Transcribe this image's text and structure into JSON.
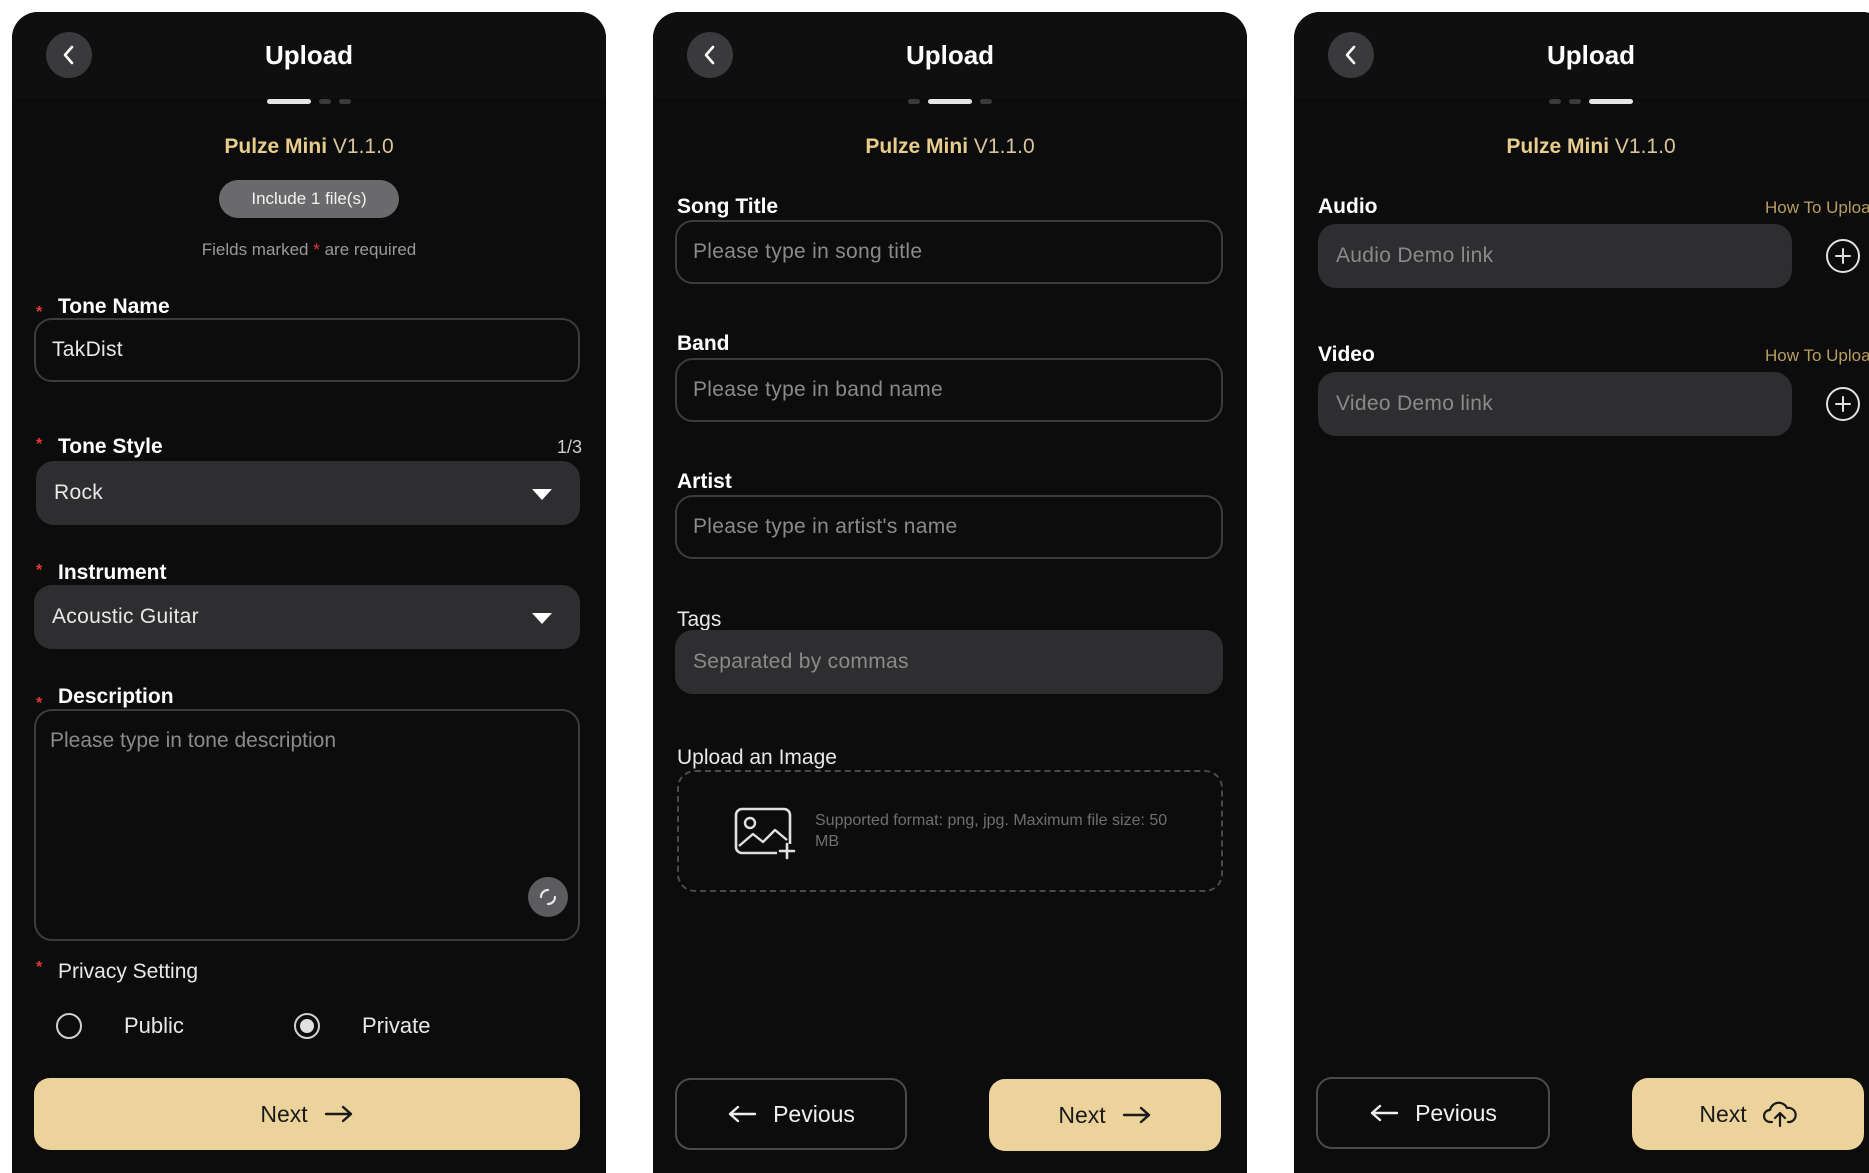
{
  "colors": {
    "accent_gold": "#ecd39b",
    "product_gold": "#e8cc8e",
    "required_red": "#e53935",
    "background": "#0c0c0c",
    "field_fill": "#2e2e30"
  },
  "screens": [
    {
      "header": {
        "title": "Upload",
        "back_icon": "chevron-left-icon"
      },
      "step": {
        "current": 1,
        "total": 3
      },
      "product": {
        "name": "Pulze Mini",
        "version": "V1.1.0"
      },
      "badge": "Include 1 file(s)",
      "required_note": {
        "before": "Fields marked",
        "star": "*",
        "after": "are required"
      },
      "tone_name": {
        "label": "Tone Name",
        "value": "TakDist"
      },
      "tone_style": {
        "label": "Tone Style",
        "counter": "1/3",
        "value": "Rock"
      },
      "instrument": {
        "label": "Instrument",
        "value": "Acoustic Guitar"
      },
      "description": {
        "label": "Description",
        "placeholder": "Please type in tone description"
      },
      "privacy": {
        "label": "Privacy Setting",
        "options": [
          {
            "label": "Public",
            "selected": false
          },
          {
            "label": "Private",
            "selected": true
          }
        ]
      },
      "next_button": {
        "label": "Next",
        "icon": "arrow-right-icon"
      }
    },
    {
      "header": {
        "title": "Upload",
        "back_icon": "chevron-left-icon"
      },
      "step": {
        "current": 2,
        "total": 3
      },
      "product": {
        "name": "Pulze Mini",
        "version": "V1.1.0"
      },
      "song_title": {
        "label": "Song Title",
        "placeholder": "Please type in song title"
      },
      "band": {
        "label": "Band",
        "placeholder": "Please type in band name"
      },
      "artist": {
        "label": "Artist",
        "placeholder": "Please type in artist's name"
      },
      "tags": {
        "label": "Tags",
        "placeholder": "Separated by commas"
      },
      "upload_image": {
        "label": "Upload an Image",
        "hint": "Supported format: png, jpg. Maximum file size: 50 MB",
        "icon": "image-add-icon"
      },
      "previous_button": {
        "label": "Pevious",
        "icon": "arrow-left-icon"
      },
      "next_button": {
        "label": "Next",
        "icon": "arrow-right-icon"
      }
    },
    {
      "header": {
        "title": "Upload",
        "back_icon": "chevron-left-icon"
      },
      "step": {
        "current": 3,
        "total": 3
      },
      "product": {
        "name": "Pulze Mini",
        "version": "V1.1.0"
      },
      "audio": {
        "label": "Audio",
        "link": "How To Upload",
        "placeholder": "Audio Demo link",
        "icon": "plus-circle-icon"
      },
      "video": {
        "label": "Video",
        "link": "How To Upload",
        "placeholder": "Video Demo link",
        "icon": "plus-circle-icon"
      },
      "previous_button": {
        "label": "Pevious",
        "icon": "arrow-left-icon"
      },
      "next_button": {
        "label": "Next",
        "icon": "cloud-upload-icon"
      }
    }
  ]
}
